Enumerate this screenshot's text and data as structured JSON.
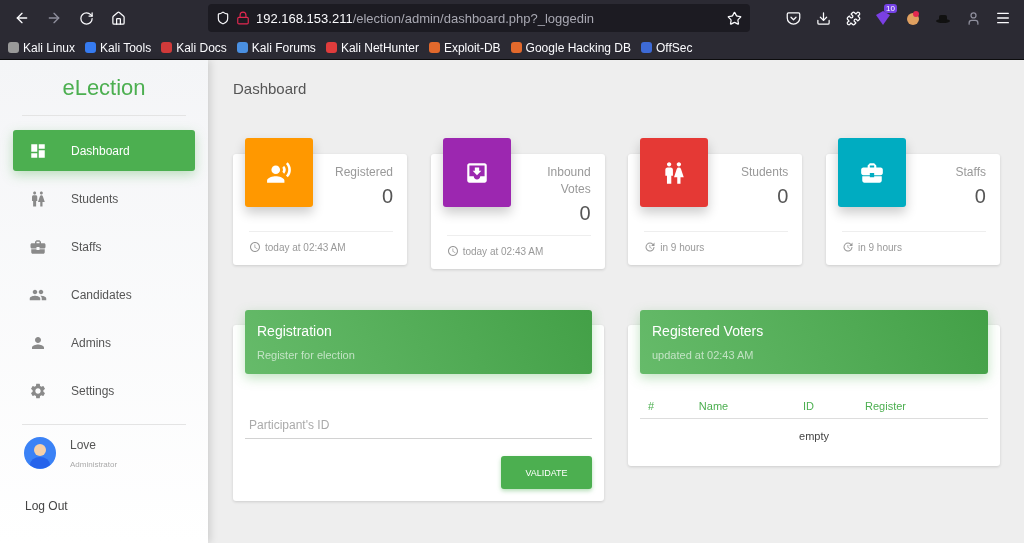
{
  "browser": {
    "address": {
      "host": "192.168.153.211",
      "path": "/election/admin/dashboard.php?_loggedin"
    },
    "extension_badge": "10",
    "bookmarks": [
      {
        "label": "Kali Linux",
        "color": "#9a9a9a"
      },
      {
        "label": "Kali Tools",
        "color": "#367bf0"
      },
      {
        "label": "Kali Docs",
        "color": "#d03a3a"
      },
      {
        "label": "Kali Forums",
        "color": "#4a90e2"
      },
      {
        "label": "Kali NetHunter",
        "color": "#e03c3c"
      },
      {
        "label": "Exploit-DB",
        "color": "#e2692c"
      },
      {
        "label": "Google Hacking DB",
        "color": "#e2692c"
      },
      {
        "label": "OffSec",
        "color": "#3d6ad6"
      }
    ]
  },
  "sidebar": {
    "brand": "eLection",
    "items": [
      {
        "label": "Dashboard",
        "selected": true
      },
      {
        "label": "Students",
        "selected": false
      },
      {
        "label": "Staffs",
        "selected": false
      },
      {
        "label": "Candidates",
        "selected": false
      },
      {
        "label": "Admins",
        "selected": false
      },
      {
        "label": "Settings",
        "selected": false
      }
    ],
    "user": {
      "name": "Love",
      "role": "Administrator"
    },
    "logout": "Log Out"
  },
  "page_title": "Dashboard",
  "stats": [
    {
      "label": "Registered",
      "value": "0",
      "footer": "today at 02:43 AM",
      "color": "#ff9800"
    },
    {
      "label": "Inbound Votes",
      "value": "0",
      "footer": "today at 02:43 AM",
      "color": "#9c27b0"
    },
    {
      "label": "Students",
      "value": "0",
      "footer": "in 9 hours",
      "color": "#e53935"
    },
    {
      "label": "Staffs",
      "value": "0",
      "footer": "in 9 hours",
      "color": "#00acc1"
    }
  ],
  "registration": {
    "title": "Registration",
    "subtitle": "Register for election",
    "field": {
      "placeholder": "Participant's ID"
    },
    "button": "VALIDATE"
  },
  "voters": {
    "title": "Registered Voters",
    "subtitle": "updated at 02:43 AM",
    "columns": [
      "#",
      "Name",
      "ID",
      "Register"
    ],
    "empty": "empty"
  }
}
